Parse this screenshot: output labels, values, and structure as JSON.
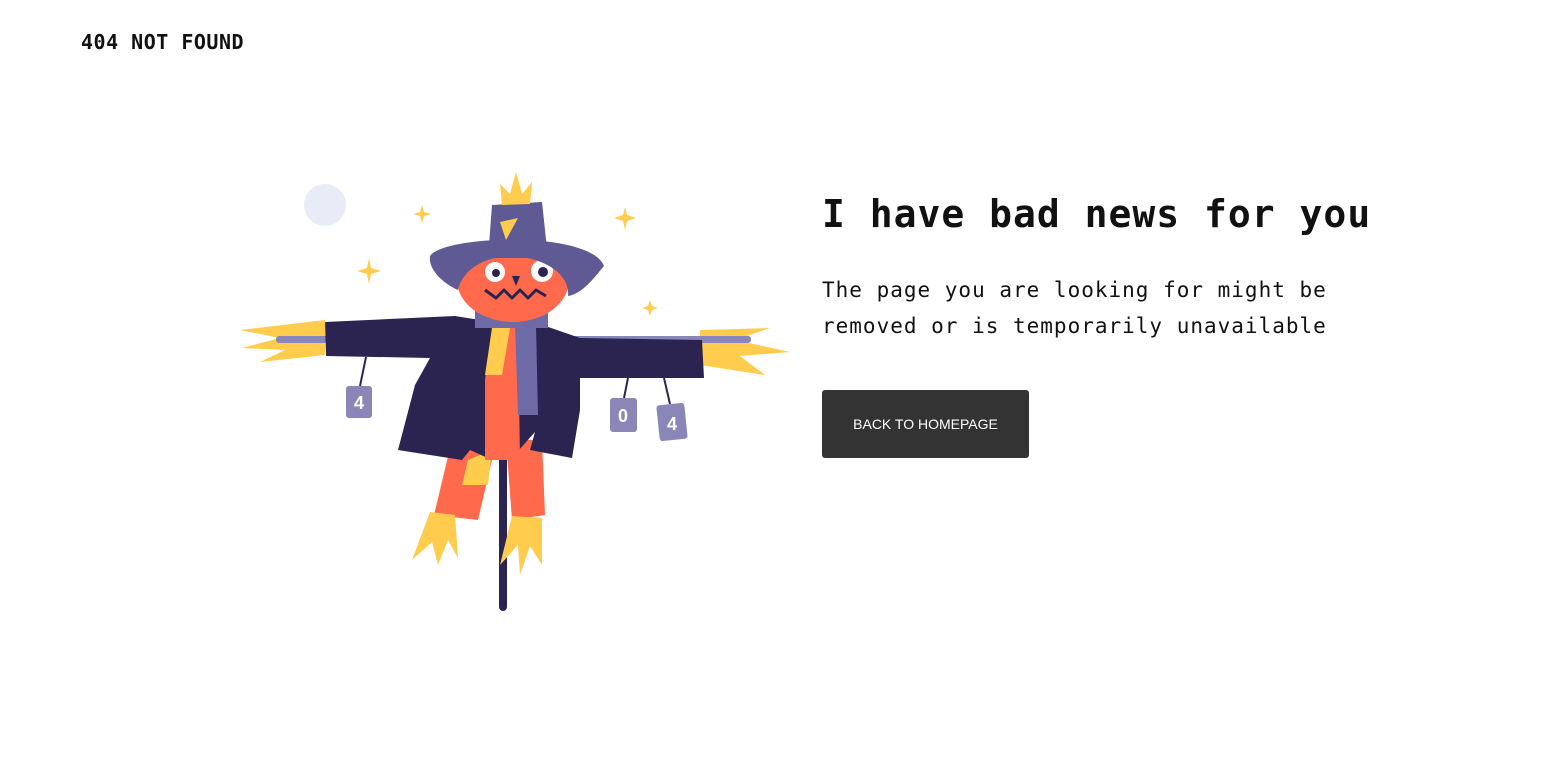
{
  "header": {
    "label": "404 NOT FOUND"
  },
  "illustration": {
    "subject": "scarecrow-illustration",
    "can_labels": [
      "4",
      "0",
      "4"
    ],
    "colors": {
      "hat": "#5f5a93",
      "coat": "#2b2450",
      "face": "#ff6a4d",
      "straw": "#ffcc4d",
      "scarf": "#6e6aa6",
      "moon": "#e8ecf6"
    }
  },
  "main": {
    "headline": "I have bad news for you",
    "message": "The page you are looking for might be removed or is temporarily unavailable",
    "button_label": "BACK TO HOMEPAGE"
  },
  "colors": {
    "button_bg": "#333333",
    "button_text": "#ffffff",
    "text": "#111111"
  }
}
